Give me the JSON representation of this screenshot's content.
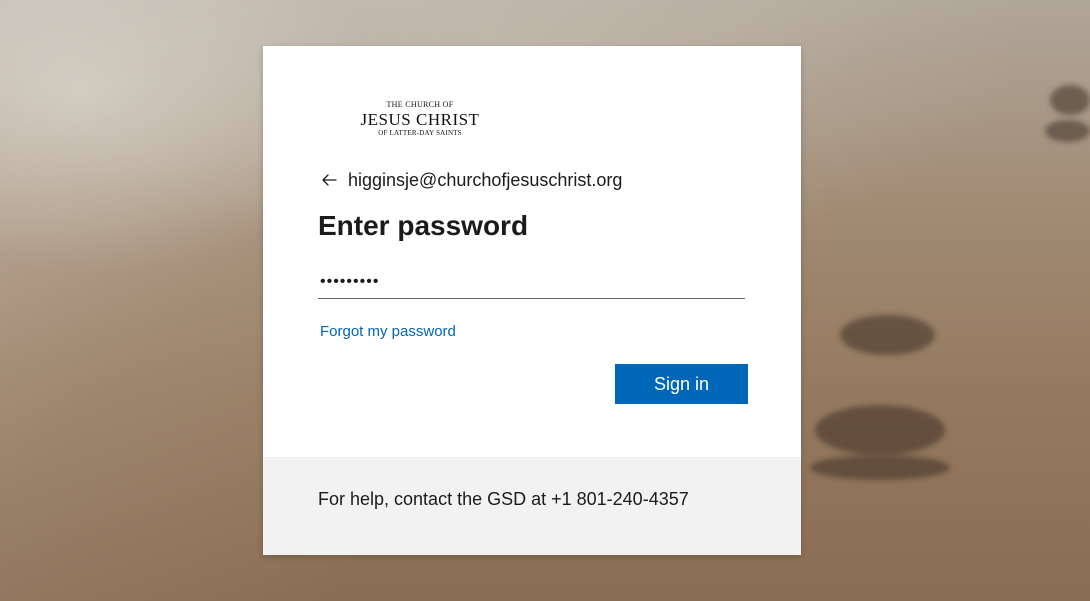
{
  "logo": {
    "line1": "THE CHURCH OF",
    "line2": "JESUS CHRIST",
    "line3": "OF LATTER-DAY SAINTS"
  },
  "identity": {
    "back_icon": "left-arrow-icon",
    "email": "higginsje@churchofjesuschrist.org"
  },
  "form": {
    "title": "Enter password",
    "password_value": "•••••••••",
    "forgot_link": "Forgot my password",
    "signin_label": "Sign in"
  },
  "footer": {
    "help_text": "For help, contact the GSD at +1 801-240-4357"
  },
  "colors": {
    "accent": "#0067b8",
    "footer_bg": "#f2f2f2",
    "card_bg": "#ffffff"
  }
}
